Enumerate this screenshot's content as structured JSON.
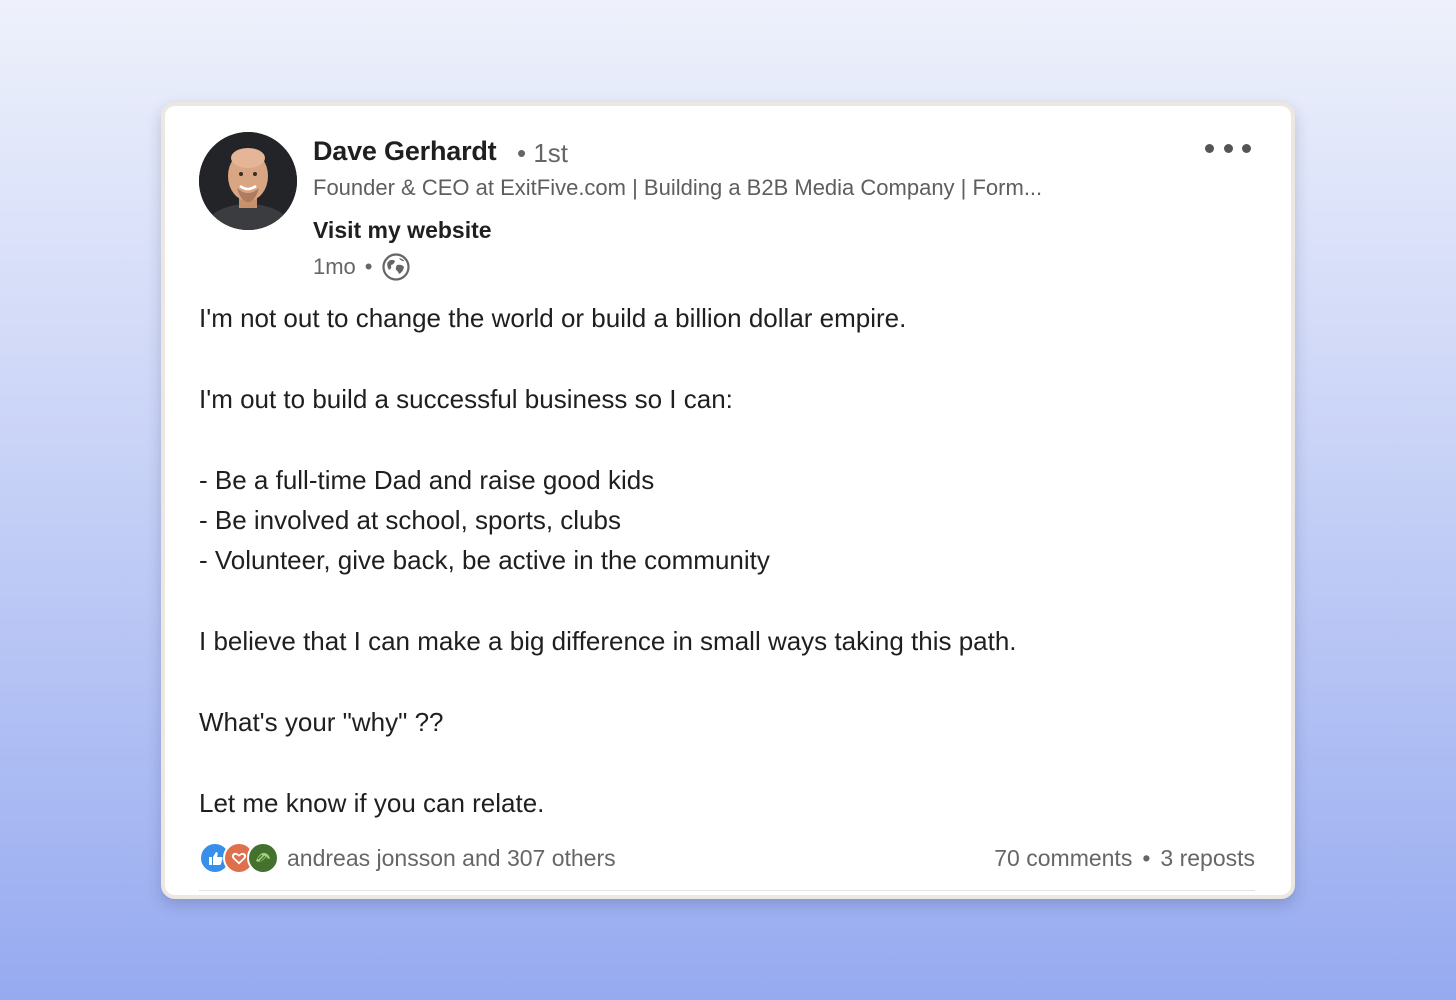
{
  "post": {
    "author": {
      "name": "Dave Gerhardt",
      "degree": "• 1st",
      "headline": "Founder & CEO at ExitFive.com | Building a B2B Media Company | Form...",
      "website_label": "Visit my website"
    },
    "time": "1mo",
    "time_separator": "•",
    "visibility_icon": "globe-icon",
    "menu_icon": "more-options-icon",
    "body": [
      "I'm not out to change the world or build a billion dollar empire.",
      "I'm out to build a successful business so I can:",
      "- Be a full-time Dad and raise good kids",
      "- Be involved at school, sports, clubs",
      "- Volunteer, give back, be active in the community",
      "I believe that I can make a big difference in small ways taking this path.",
      "What's your \"why\" ??",
      "Let me know if you can relate."
    ],
    "social": {
      "reaction_icons": [
        "like-icon",
        "love-icon",
        "support-icon"
      ],
      "reactions_text": "andreas jonsson and 307 others",
      "comments": "70 comments",
      "separator": "•",
      "reposts": "3 reposts"
    }
  },
  "colors": {
    "like": "#378fe9",
    "love": "#df704d",
    "support": "#44712e",
    "text": "#1f1f1f",
    "secondary_text": "#666666"
  }
}
